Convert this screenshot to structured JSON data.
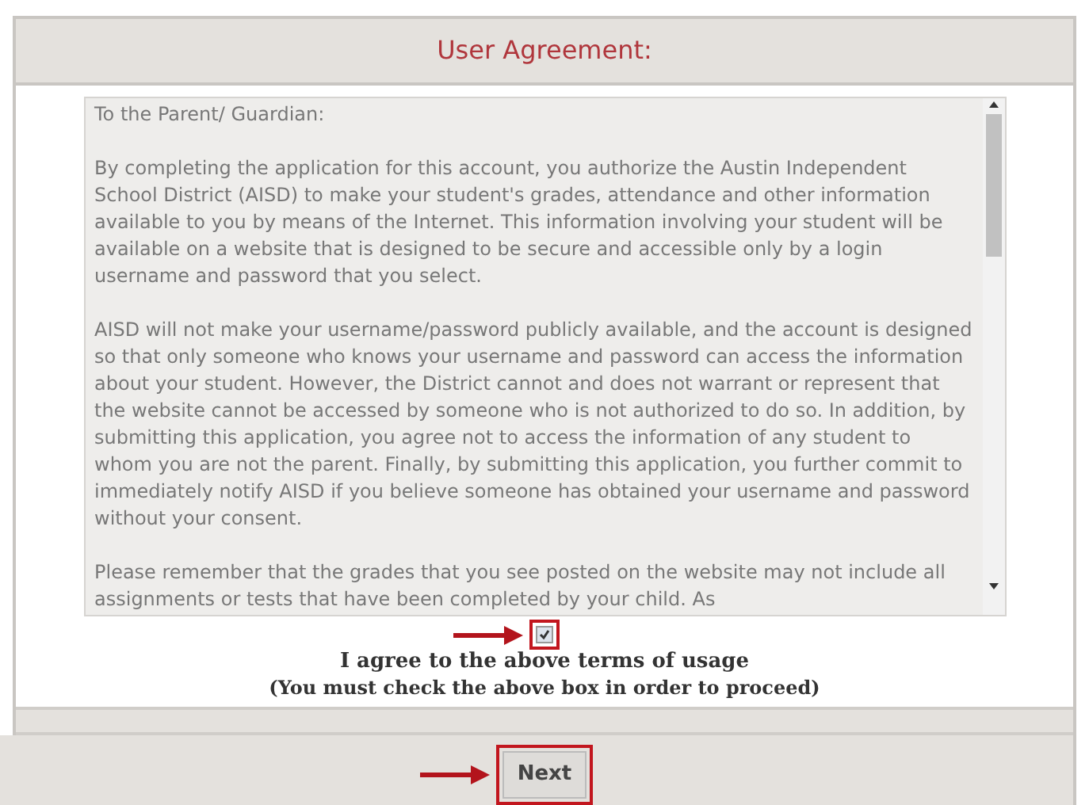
{
  "header": {
    "title": "User Agreement:"
  },
  "agreement": {
    "paragraphs": [
      "To the Parent/ Guardian:",
      "By completing the application for this account, you authorize the Austin Independent School District (AISD) to make your student's grades, attendance and other information available to you by means of the Internet. This information involving your student will be available on a website that is designed to be secure and accessible only by a login username and password that you select.",
      "AISD will not make your username/password publicly available, and the account is designed so that only someone who knows your username and password can access the information about your student.  However, the District cannot and does not warrant or represent that the website cannot be accessed by someone who is not authorized to do so. In addition, by submitting this application, you agree not to access the information of any student to whom you are not the parent.  Finally, by submitting this application, you further commit to immediately notify AISD if you believe someone has obtained your username and password without your consent.",
      "Please remember that the grades that you see posted on the website may not include all assignments or tests that have been completed by your child.  As"
    ]
  },
  "consent": {
    "checked": true,
    "label": "I agree to the above terms of usage",
    "note": "(You must check the above box in order to proceed)"
  },
  "buttons": [
    {
      "label": "Next"
    }
  ]
}
